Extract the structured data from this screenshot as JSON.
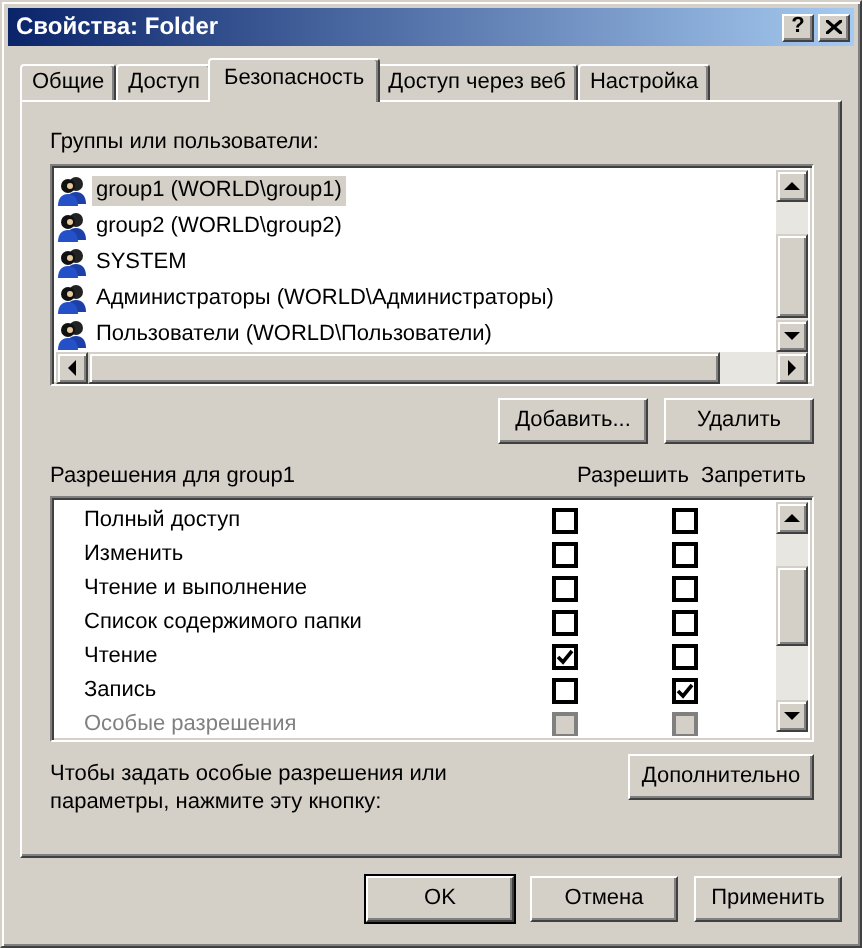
{
  "window": {
    "title": "Свойства: Folder",
    "help": "?"
  },
  "tabs": [
    {
      "label": "Общие",
      "selected": false
    },
    {
      "label": "Доступ",
      "selected": false
    },
    {
      "label": "Безопасность",
      "selected": true
    },
    {
      "label": "Доступ через веб",
      "selected": false
    },
    {
      "label": "Настройка",
      "selected": false
    }
  ],
  "users": {
    "label": "Группы или пользователи:",
    "items": [
      {
        "name": "group1 (WORLD\\group1)",
        "selected": true
      },
      {
        "name": "group2 (WORLD\\group2)",
        "selected": false
      },
      {
        "name": "SYSTEM",
        "selected": false
      },
      {
        "name": "Администраторы (WORLD\\Администраторы)",
        "selected": false
      },
      {
        "name": "Пользователи (WORLD\\Пользователи)",
        "selected": false
      }
    ],
    "buttons": [
      "Добавить...",
      "Удалить"
    ]
  },
  "permissions": {
    "label": "Разрешения для group1",
    "columns": [
      "Разрешить",
      "Запретить"
    ],
    "rows": [
      {
        "name": "Полный доступ",
        "allow": false,
        "deny": false,
        "disabled": false
      },
      {
        "name": "Изменить",
        "allow": false,
        "deny": false,
        "disabled": false
      },
      {
        "name": "Чтение и выполнение",
        "allow": false,
        "deny": false,
        "disabled": false
      },
      {
        "name": "Список содержимого папки",
        "allow": false,
        "deny": false,
        "disabled": false
      },
      {
        "name": "Чтение",
        "allow": true,
        "deny": false,
        "disabled": false
      },
      {
        "name": "Запись",
        "allow": false,
        "deny": true,
        "disabled": false
      },
      {
        "name": "Особые разрешения",
        "allow": false,
        "deny": false,
        "disabled": true
      }
    ]
  },
  "advanced": {
    "text": "Чтобы задать особые разрешения или параметры, нажмите эту кнопку:",
    "button": "Дополнительно"
  },
  "footer_buttons": [
    {
      "label": "OK",
      "default": true
    },
    {
      "label": "Отмена",
      "default": false
    },
    {
      "label": "Применить",
      "default": false
    }
  ]
}
